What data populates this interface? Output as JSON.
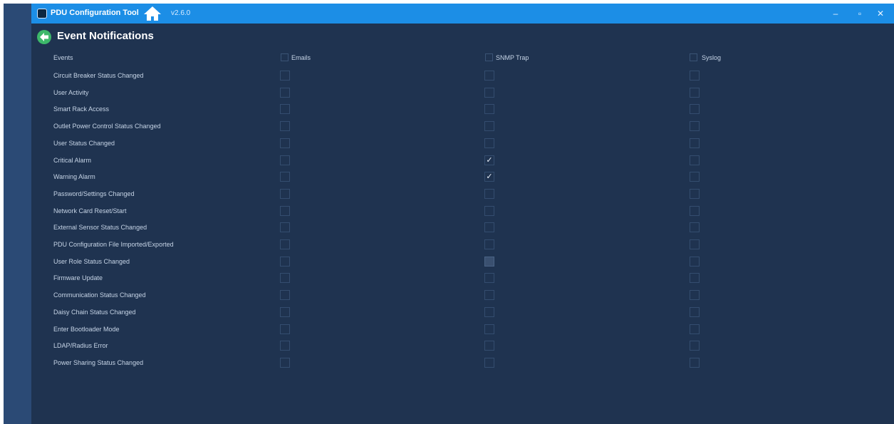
{
  "app": {
    "title": "PDU Configuration Tool",
    "version": "v2.6.0"
  },
  "window_controls": {
    "minimize": "–",
    "maximize": "▫",
    "close": "✕"
  },
  "page": {
    "title": "Event Notifications"
  },
  "columns": {
    "events": "Events",
    "emails": "Emails",
    "snmp": "SNMP Trap",
    "syslog": "Syslog"
  },
  "events": [
    {
      "label": "Circuit Breaker Status Changed",
      "email": false,
      "snmp": false,
      "syslog": false
    },
    {
      "label": "User Activity",
      "email": false,
      "snmp": false,
      "syslog": false
    },
    {
      "label": "Smart Rack Access",
      "email": false,
      "snmp": false,
      "syslog": false
    },
    {
      "label": "Outlet Power Control Status Changed",
      "email": false,
      "snmp": false,
      "syslog": false
    },
    {
      "label": "User Status Changed",
      "email": false,
      "snmp": false,
      "syslog": false
    },
    {
      "label": "Critical Alarm",
      "email": false,
      "snmp": true,
      "syslog": false
    },
    {
      "label": "Warning Alarm",
      "email": false,
      "snmp": true,
      "syslog": false
    },
    {
      "label": "Password/Settings Changed",
      "email": false,
      "snmp": false,
      "syslog": false
    },
    {
      "label": "Network Card Reset/Start",
      "email": false,
      "snmp": false,
      "syslog": false
    },
    {
      "label": "External Sensor Status Changed",
      "email": false,
      "snmp": false,
      "syslog": false
    },
    {
      "label": "PDU Configuration File Imported/Exported",
      "email": false,
      "snmp": false,
      "syslog": false
    },
    {
      "label": "User Role Status Changed",
      "email": false,
      "snmp": false,
      "snmp_disabled": true,
      "syslog": false
    },
    {
      "label": "Firmware Update",
      "email": false,
      "snmp": false,
      "syslog": false
    },
    {
      "label": "Communication Status Changed",
      "email": false,
      "snmp": false,
      "syslog": false
    },
    {
      "label": "Daisy Chain Status Changed",
      "email": false,
      "snmp": false,
      "syslog": false
    },
    {
      "label": "Enter Bootloader Mode",
      "email": false,
      "snmp": false,
      "syslog": false
    },
    {
      "label": "LDAP/Radius Error",
      "email": false,
      "snmp": false,
      "syslog": false
    },
    {
      "label": "Power Sharing Status Changed",
      "email": false,
      "snmp": false,
      "syslog": false
    }
  ],
  "checkmark": "✓",
  "colors": {
    "titlebar": "#1c8ee6",
    "background": "#1f3350",
    "left_strip": "#2b4a75",
    "back_button": "#3db86a"
  },
  "icons": {
    "app": "app-icon",
    "home": "home-icon",
    "back": "back-arrow-icon"
  }
}
